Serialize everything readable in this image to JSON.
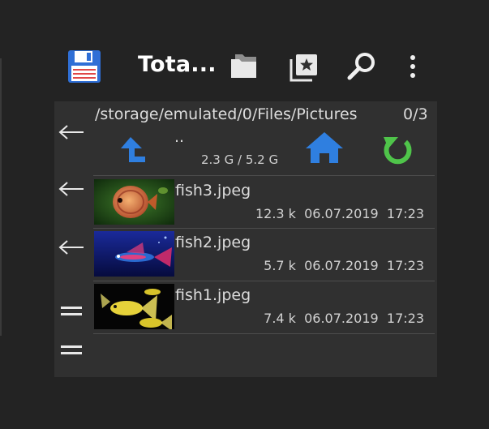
{
  "toolbar": {
    "title": "Tota...",
    "icons": [
      "save-icon",
      "folders-icon",
      "bookmarks-icon",
      "search-icon",
      "more-vert-icon"
    ]
  },
  "path_bar": {
    "path": "/storage/emulated/0/Files/Pictures",
    "count": "0/3"
  },
  "nav_row": {
    "up_label": "..",
    "space": "2.3 G / 5.2 G",
    "icons": [
      "up-folder-icon",
      "home-icon",
      "refresh-icon"
    ]
  },
  "files": [
    {
      "name": "fish3.jpeg",
      "size": "12.3 k",
      "date": "06.07.2019",
      "time": "17:23"
    },
    {
      "name": "fish2.jpeg",
      "size": "5.7 k",
      "date": "06.07.2019",
      "time": "17:23"
    },
    {
      "name": "fish1.jpeg",
      "size": "7.4 k",
      "date": "06.07.2019",
      "time": "17:23"
    }
  ],
  "side_icons": [
    "back-arrow-icon",
    "back-arrow-icon",
    "back-arrow-icon",
    "menu-lines-icon",
    "menu-lines-icon"
  ],
  "colors": {
    "background": "#232323",
    "panel": "#303030",
    "up_arrow": "#2f7fe0",
    "home": "#2f7fe0",
    "refresh": "#4fc44a",
    "save_icon": "#2f6fd6"
  }
}
